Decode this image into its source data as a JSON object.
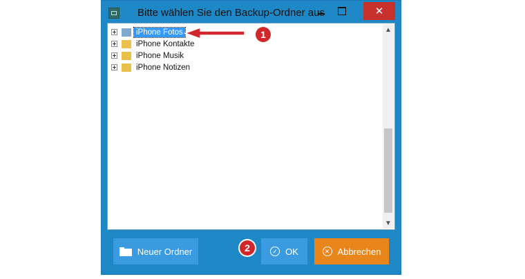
{
  "window": {
    "title": "Bitte wählen Sie den Backup-Ordner aus",
    "controls": {
      "minimize": "minimize-icon",
      "maximize": "maximize-icon",
      "close": "✕"
    }
  },
  "tree": {
    "items": [
      {
        "label": "iPhone Fotos",
        "selected": true,
        "icon": "folder-icon",
        "icon_color": "#7fa9cf"
      },
      {
        "label": "iPhone Kontakte",
        "selected": false,
        "icon": "folder-icon",
        "icon_color": "#e8c04b"
      },
      {
        "label": "iPhone Musik",
        "selected": false,
        "icon": "folder-icon",
        "icon_color": "#e8c04b"
      },
      {
        "label": "iPhone Notizen",
        "selected": false,
        "icon": "folder-icon",
        "icon_color": "#e8c04b"
      }
    ]
  },
  "scrollbar": {
    "up": "▲",
    "down": "▼"
  },
  "buttons": {
    "new_folder": "Neuer Ordner",
    "ok": "OK",
    "ok_icon": "✓",
    "cancel": "Abbrechen",
    "cancel_icon": "✕"
  },
  "annotations": {
    "badge_1": "1",
    "badge_2": "2"
  },
  "colors": {
    "window_frame": "#1e88c7",
    "selection": "#3399ff",
    "button_blue": "#3a9be0",
    "button_orange": "#e8861b",
    "close_red": "#c7302b",
    "badge_red": "#d0282a"
  }
}
